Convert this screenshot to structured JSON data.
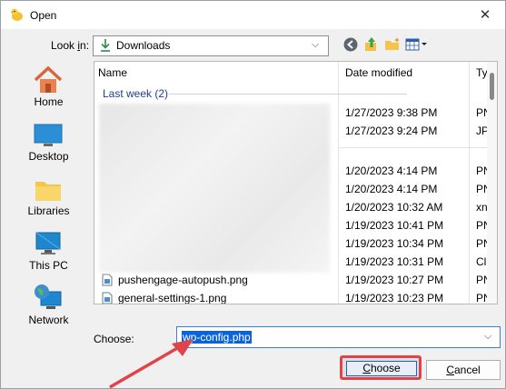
{
  "window": {
    "title": "Open",
    "close_glyph": "✕"
  },
  "toolbar": {
    "look_in_label": "Look in:",
    "look_in_value": "Downloads",
    "icons": [
      "back-icon",
      "up-folder-icon",
      "new-folder-icon",
      "view-menu-icon"
    ]
  },
  "places": [
    {
      "label": "Home",
      "icon": "home-icon"
    },
    {
      "label": "Desktop",
      "icon": "desktop-icon"
    },
    {
      "label": "Libraries",
      "icon": "libraries-icon"
    },
    {
      "label": "This PC",
      "icon": "this-pc-icon"
    },
    {
      "label": "Network",
      "icon": "network-icon"
    }
  ],
  "filelist": {
    "columns": {
      "name": "Name",
      "date": "Date modified",
      "type": "Ty"
    },
    "group_label": "Last week (2)",
    "rows": [
      {
        "name": "",
        "date": "1/27/2023 9:38 PM",
        "type": "PN"
      },
      {
        "name": "",
        "date": "1/27/2023 9:24 PM",
        "type": "JP"
      },
      {
        "name": "",
        "date": "1/20/2023 4:14 PM",
        "type": "PN"
      },
      {
        "name": "",
        "date": "1/20/2023 4:14 PM",
        "type": "PN"
      },
      {
        "name": "",
        "date": "1/20/2023 10:32 AM",
        "type": "xn"
      },
      {
        "name": "",
        "date": "1/19/2023 10:41 PM",
        "type": "PN"
      },
      {
        "name": "",
        "date": "1/19/2023 10:34 PM",
        "type": "PN"
      },
      {
        "name": "",
        "date": "1/19/2023 10:31 PM",
        "type": "Cl"
      },
      {
        "name": "pushengage-autopush.png",
        "date": "1/19/2023 10:27 PM",
        "type": "PN"
      },
      {
        "name": "general-settings-1.png",
        "date": "1/19/2023 10:23 PM",
        "type": "PN"
      }
    ]
  },
  "choose": {
    "label": "Choose:",
    "value": "wp-config.php"
  },
  "buttons": {
    "choose": "Choose",
    "cancel": "Cancel"
  },
  "colors": {
    "annotation_red": "#e0434a",
    "selection_blue": "#0a64d6"
  }
}
